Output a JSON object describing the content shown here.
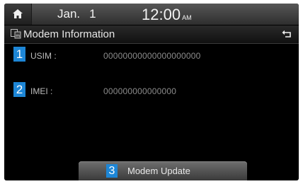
{
  "status_bar": {
    "home_icon": "home-icon",
    "date_month": "Jan.",
    "date_day": "1",
    "time": "12:00",
    "ampm": "AM"
  },
  "title_bar": {
    "title": "Modem Information",
    "modem_icon": "modem-info-icon",
    "back_icon": "back-arrow-icon"
  },
  "rows": [
    {
      "number": "1",
      "label": "USIM :",
      "value": "00000000000000000000"
    },
    {
      "number": "2",
      "label": "IMEI :",
      "value": "000000000000000"
    }
  ],
  "update_button": {
    "number": "3",
    "label": "Modem Update"
  },
  "colors": {
    "badge": "#1d86d6",
    "background": "#000000"
  }
}
